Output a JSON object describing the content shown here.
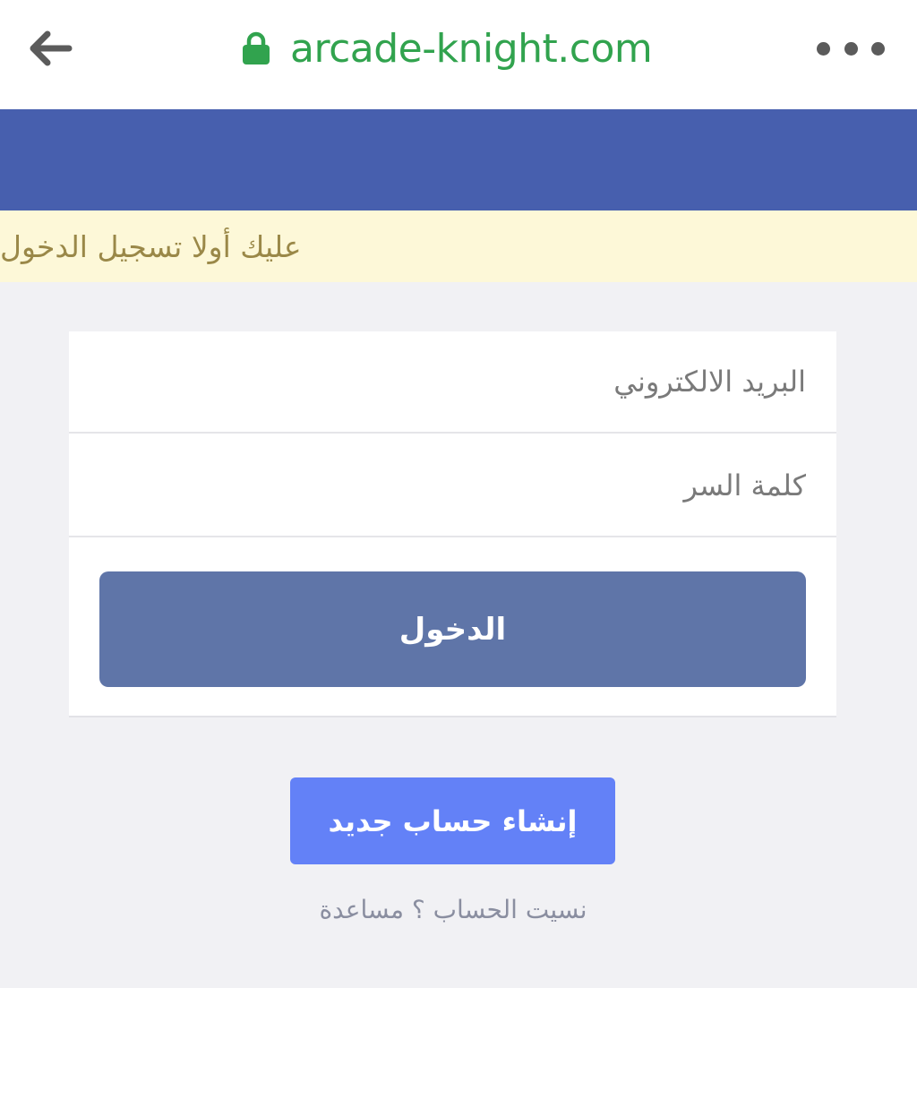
{
  "browser": {
    "url": "arcade-knight.com",
    "url_color": "#31a34e"
  },
  "colors": {
    "header_band": "#475fae",
    "notice_bg": "#fdf8d8",
    "login_button": "#5f75a8",
    "signup_button": "#6381f7",
    "content_bg": "#f1f1f4"
  },
  "notice": {
    "text": "عليك أولا تسجيل الدخول"
  },
  "login_form": {
    "email_placeholder": "البريد الالكتروني",
    "password_placeholder": "كلمة السر",
    "login_label": "الدخول"
  },
  "signup": {
    "label": "إنشاء حساب جديد"
  },
  "help": {
    "text": "نسيت الحساب ؟ مساعدة"
  },
  "icons": {
    "back": "arrow-left-icon",
    "lock": "lock-icon",
    "more": "more-horizontal-icon"
  }
}
